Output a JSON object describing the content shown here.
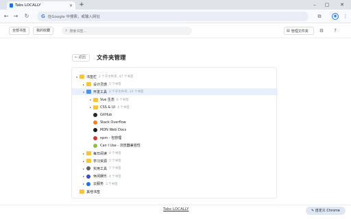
{
  "browser": {
    "tab_title": "Tabs LOCALLY",
    "omnibox_placeholder": "在Google 中搜索，或输入网址",
    "customize_label": "自定义 Chrome"
  },
  "header": {
    "all_bookmarks": "全部书签",
    "my_favorites": "我的收藏",
    "search_placeholder": "搜索书签...",
    "manage_folders": "管理文件夹"
  },
  "page": {
    "back_label": "返回",
    "title": "文件夹管理"
  },
  "tree": [
    {
      "label": "书签栏",
      "count": "2 个子文件夹, 47 个书签",
      "level": 0,
      "type": "folder",
      "caret": "▾"
    },
    {
      "label": "设计灵感",
      "count": "5 个书签",
      "level": 1,
      "type": "folder",
      "caret": "▸"
    },
    {
      "label": "开发工具",
      "count": "2 个子文件夹, 14 个书签",
      "level": 1,
      "type": "folder-blue",
      "caret": "▾",
      "selected": true
    },
    {
      "label": "Vue 生态",
      "count": "6 个书签",
      "level": 2,
      "type": "folder",
      "caret": "▸"
    },
    {
      "label": "CSS & UI",
      "count": "4 个书签",
      "level": 2,
      "type": "folder",
      "caret": "▸"
    },
    {
      "label": "GitHub",
      "level": 2,
      "type": "site",
      "icon": "github-icon",
      "color": "#24292f"
    },
    {
      "label": "Stack Overflow",
      "level": 2,
      "type": "site",
      "icon": "stackoverflow-icon",
      "color": "#f48024"
    },
    {
      "label": "MDN Web Docs",
      "level": 2,
      "type": "site",
      "icon": "mdn-icon",
      "color": "#1b1b1b"
    },
    {
      "label": "npm - 包管理",
      "level": 2,
      "type": "site",
      "icon": "npm-icon",
      "color": "#cb3837"
    },
    {
      "label": "Can I Use - 浏览器兼容性",
      "level": 2,
      "type": "site",
      "icon": "caniuse-icon",
      "color": "#8bbf4d"
    },
    {
      "label": "每日阅读",
      "count": "8 个书签",
      "level": 1,
      "type": "folder",
      "caret": "▸"
    },
    {
      "label": "学习资源",
      "count": "5 个书签",
      "level": 1,
      "type": "folder",
      "caret": "▸"
    },
    {
      "label": "实用工具",
      "count": "7 个书签",
      "level": 1,
      "type": "site-folder",
      "icon": "tools-icon",
      "color": "#5f6368",
      "caret": "▸"
    },
    {
      "label": "休闲娱乐",
      "count": "4 个书签",
      "level": 1,
      "type": "site-folder",
      "icon": "gamepad-icon",
      "color": "#3c4cc8",
      "caret": "▸"
    },
    {
      "label": "云服务",
      "count": "3 个书签",
      "level": 1,
      "type": "site-folder",
      "icon": "cloud-icon",
      "color": "#1a73e8",
      "caret": "▸"
    },
    {
      "label": "其他书签",
      "level": 0,
      "type": "folder",
      "caret": ""
    }
  ],
  "footer": {
    "link": "Tabs LOCALLY"
  }
}
